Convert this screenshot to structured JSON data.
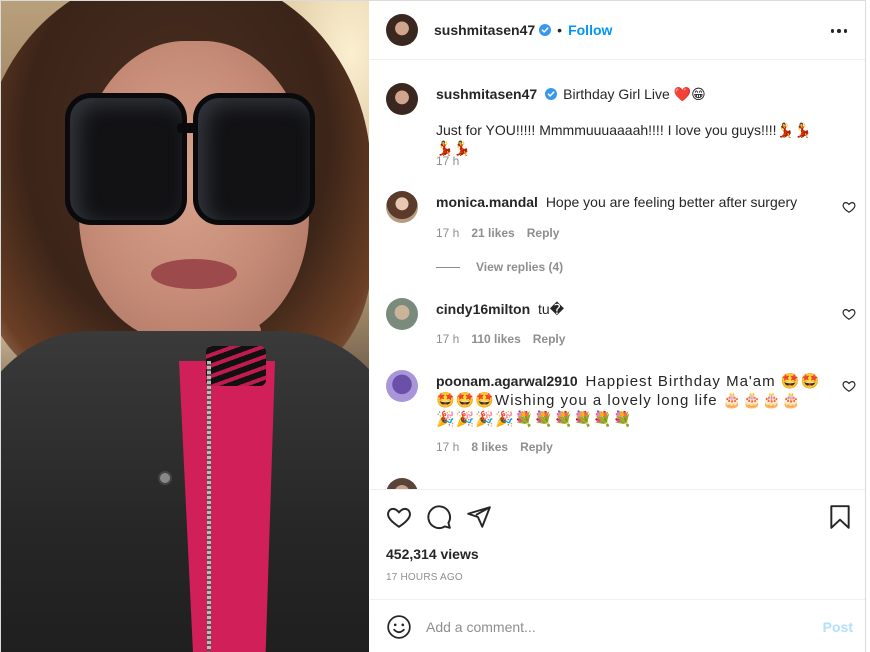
{
  "post": {
    "owner": {
      "username": "sushmitasen47",
      "verified": true,
      "follow_label": "Follow",
      "separator": "•",
      "avatar_icon": "profile-avatar"
    },
    "caption": {
      "username": "sushmitasen47",
      "title": "Birthday Girl Live ❤️😁",
      "text": "Just for YOU!!!!! Mmmmuuuaaaah!!!! I love you guys!!!!💃💃💃💃",
      "time": "17 h"
    },
    "comments": [
      {
        "username": "monica.mandal",
        "text": "Hope you are feeling better after surgery",
        "time": "17 h",
        "likes": "21 likes",
        "reply_label": "Reply",
        "view_replies": "View replies (4)"
      },
      {
        "username": "cindy16milton",
        "text": "tu�",
        "time": "17 h",
        "likes": "110 likes",
        "reply_label": "Reply"
      },
      {
        "username": "poonam.agarwal2910",
        "text": "Happiest Birthday Ma'am 🤩🤩🤩🤩🤩Wishing you a lovely long life 🎂🎂🎂🎂🎉🎉🎉🎉💐💐💐💐💐💐",
        "time": "17 h",
        "likes": "8 likes",
        "reply_label": "Reply"
      }
    ],
    "actions": {
      "like_icon": "heart-icon",
      "comment_icon": "comment-bubble-icon",
      "share_icon": "paper-plane-icon",
      "save_icon": "bookmark-icon"
    },
    "views": "452,314 views",
    "time_ago": "17 HOURS AGO",
    "add_comment": {
      "placeholder": "Add a comment...",
      "post_label": "Post",
      "emoji_icon": "smiley-icon"
    },
    "more_icon": "more-options-icon"
  },
  "colors": {
    "link_blue": "#0095f6",
    "post_disabled": "#b2dffc",
    "muted_text": "#8e8e8e",
    "text": "#262626",
    "like_red": "#ed4956"
  }
}
